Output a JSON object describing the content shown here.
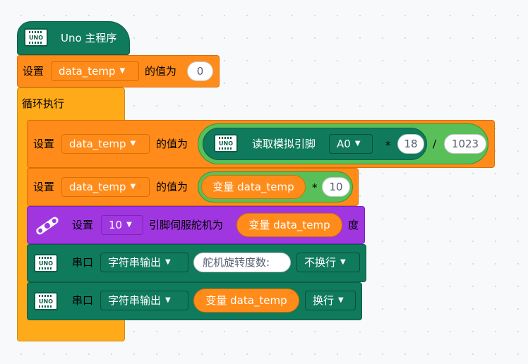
{
  "hat": {
    "label": "Uno 主程序"
  },
  "board_icon_label": "UNO",
  "set1": {
    "set": "设置",
    "var": "data_temp",
    "value_of": "的值为",
    "value": "0"
  },
  "loop": {
    "label": "循环执行"
  },
  "set2": {
    "set": "设置",
    "var": "data_temp",
    "value_of": "的值为",
    "read_label": "读取模拟引脚",
    "pin": "A0",
    "mul_op": "*",
    "mul_val": "18",
    "div_op": "/",
    "div_val": "1023"
  },
  "set3": {
    "set": "设置",
    "var": "data_temp",
    "value_of": "的值为",
    "var_reporter": "变量 data_temp",
    "mul_op": "*",
    "mul_val": "10"
  },
  "servo": {
    "set": "设置",
    "pin": "10",
    "servo_label": "引脚伺服舵机为",
    "var_reporter": "变量 data_temp",
    "unit": "度"
  },
  "serial1": {
    "label": "串口",
    "mode": "字符串输出",
    "text": "舵机旋转度数:",
    "newline": "不换行"
  },
  "serial2": {
    "label": "串口",
    "mode": "字符串输出",
    "var_reporter": "变量 data_temp",
    "newline": "换行"
  },
  "colors": {
    "control_orange": "#ff8c1a",
    "loop_yellow": "#ffab19",
    "arduino_teal": "#0f7a5c",
    "servo_purple": "#9f36e0",
    "operator_green": "#59c059"
  },
  "icons": [
    "uno-board-icon",
    "servo-icon",
    "caret-down-icon"
  ]
}
